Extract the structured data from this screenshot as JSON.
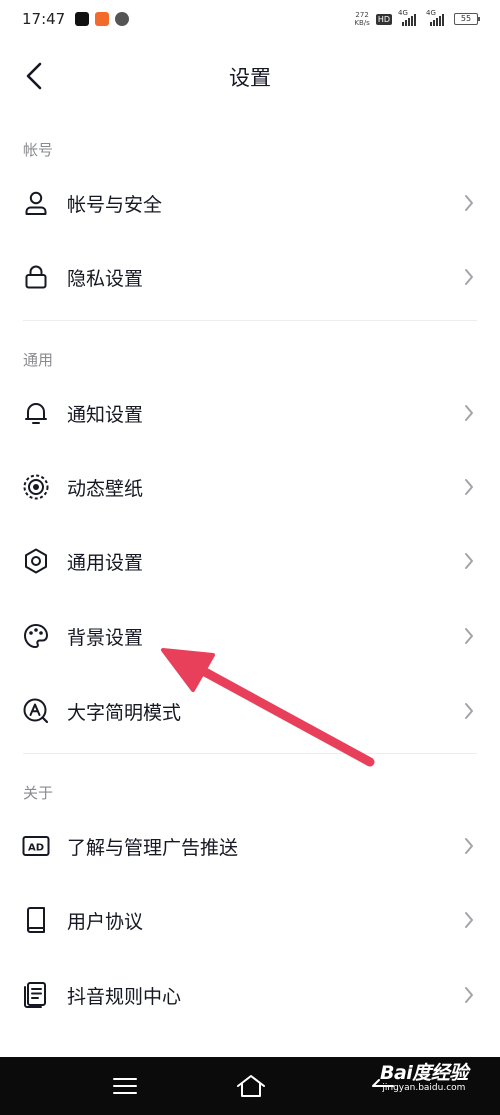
{
  "status_bar": {
    "time": "17:47",
    "net_speed_value": "272",
    "net_speed_unit": "KB/s",
    "hd_label": "HD",
    "signal_label_1": "4G",
    "signal_label_2": "4G",
    "battery": "55"
  },
  "header": {
    "title": "设置"
  },
  "sections": [
    {
      "title": "帐号",
      "items": [
        {
          "label": "帐号与安全",
          "icon": "user-icon"
        },
        {
          "label": "隐私设置",
          "icon": "lock-icon"
        }
      ]
    },
    {
      "title": "通用",
      "items": [
        {
          "label": "通知设置",
          "icon": "bell-icon"
        },
        {
          "label": "动态壁纸",
          "icon": "live-wallpaper-icon"
        },
        {
          "label": "通用设置",
          "icon": "gear-icon"
        },
        {
          "label": "背景设置",
          "icon": "palette-icon"
        },
        {
          "label": "大字简明模式",
          "icon": "large-text-icon"
        }
      ]
    },
    {
      "title": "关于",
      "items": [
        {
          "label": "了解与管理广告推送",
          "icon": "ad-icon",
          "icon_text": "AD"
        },
        {
          "label": "用户协议",
          "icon": "book-icon"
        },
        {
          "label": "抖音规则中心",
          "icon": "document-icon"
        }
      ]
    }
  ],
  "watermark": {
    "brand": "Bai度经验",
    "url": "jingyan.baidu.com"
  },
  "colors": {
    "text_primary": "#161823",
    "text_secondary": "#8a8b91",
    "annotation_arrow": "#e8405a",
    "nav_bar": "#0b0b0b"
  }
}
